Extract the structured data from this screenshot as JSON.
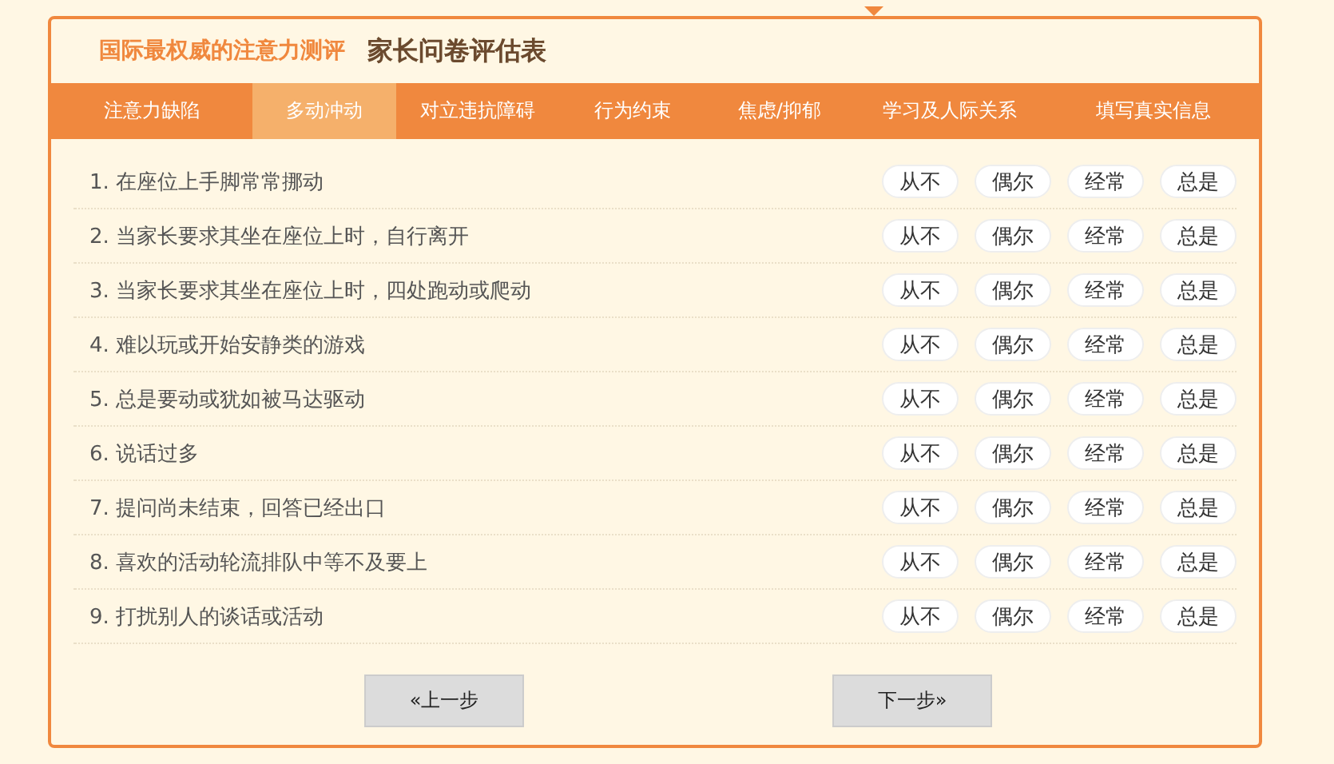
{
  "header": {
    "title": "国际最权威的注意力测评",
    "subtitle": "家长问卷评估表"
  },
  "tabs": [
    {
      "label": "注意力缺陷",
      "selected": false
    },
    {
      "label": "多动冲动",
      "selected": true
    },
    {
      "label": "对立违抗障碍",
      "selected": false
    },
    {
      "label": "行为约束",
      "selected": false
    },
    {
      "label": "焦虑/抑郁",
      "selected": false
    },
    {
      "label": "学习及人际关系",
      "selected": false
    },
    {
      "label": "填写真实信息",
      "selected": false
    }
  ],
  "questions": [
    {
      "text": "1. 在座位上手脚常常挪动",
      "options": [
        {
          "label": "从不",
          "selected": false
        },
        {
          "label": "偶尔",
          "selected": false
        },
        {
          "label": "经常",
          "selected": false
        },
        {
          "label": "总是",
          "selected": false
        }
      ]
    },
    {
      "text": "2. 当家长要求其坐在座位上时，自行离开",
      "options": [
        {
          "label": "从不",
          "selected": false
        },
        {
          "label": "偶尔",
          "selected": false
        },
        {
          "label": "经常",
          "selected": false
        },
        {
          "label": "总是",
          "selected": false
        }
      ]
    },
    {
      "text": "3. 当家长要求其坐在座位上时，四处跑动或爬动",
      "options": [
        {
          "label": "从不",
          "selected": false
        },
        {
          "label": "偶尔",
          "selected": false
        },
        {
          "label": "经常",
          "selected": false
        },
        {
          "label": "总是",
          "selected": false
        }
      ]
    },
    {
      "text": "4. 难以玩或开始安静类的游戏",
      "options": [
        {
          "label": "从不",
          "selected": false
        },
        {
          "label": "偶尔",
          "selected": false
        },
        {
          "label": "经常",
          "selected": false
        },
        {
          "label": "总是",
          "selected": false
        }
      ]
    },
    {
      "text": "5. 总是要动或犹如被马达驱动",
      "options": [
        {
          "label": "从不",
          "selected": false
        },
        {
          "label": "偶尔",
          "selected": false
        },
        {
          "label": "经常",
          "selected": false
        },
        {
          "label": "总是",
          "selected": false
        }
      ]
    },
    {
      "text": "6. 说话过多",
      "options": [
        {
          "label": "从不",
          "selected": false
        },
        {
          "label": "偶尔",
          "selected": false
        },
        {
          "label": "经常",
          "selected": false
        },
        {
          "label": "总是",
          "selected": false
        }
      ]
    },
    {
      "text": "7. 提问尚未结束，回答已经出口",
      "options": [
        {
          "label": "从不",
          "selected": false
        },
        {
          "label": "偶尔",
          "selected": false
        },
        {
          "label": "经常",
          "selected": false
        },
        {
          "label": "总是",
          "selected": false
        }
      ]
    },
    {
      "text": "8. 喜欢的活动轮流排队中等不及要上",
      "options": [
        {
          "label": "从不",
          "selected": false
        },
        {
          "label": "偶尔",
          "selected": false
        },
        {
          "label": "经常",
          "selected": false
        },
        {
          "label": "总是",
          "selected": false
        }
      ]
    },
    {
      "text": "9. 打扰别人的谈话或活动",
      "options": [
        {
          "label": "从不",
          "selected": false
        },
        {
          "label": "偶尔",
          "selected": false
        },
        {
          "label": "经常",
          "selected": false
        },
        {
          "label": "总是",
          "selected": false
        }
      ]
    }
  ],
  "buttons": {
    "prev": "«上一步",
    "next": "下一步»"
  }
}
